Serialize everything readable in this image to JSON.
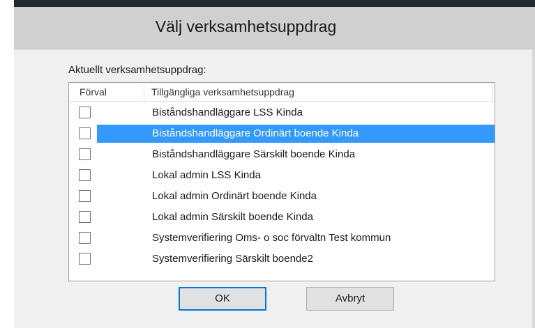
{
  "dialog": {
    "title": "Välj verksamhetsuppdrag",
    "group_label": "Aktuellt verksamhetsuppdrag:"
  },
  "list": {
    "columns": [
      "Förval",
      "Tillgängliga verksamhetsuppdrag"
    ],
    "rows": [
      {
        "label": "Biståndshandläggare LSS Kinda",
        "checked": false,
        "selected": false
      },
      {
        "label": "Biståndshandläggare Ordinärt boende Kinda",
        "checked": false,
        "selected": true
      },
      {
        "label": "Biståndshandläggare Särskilt boende Kinda",
        "checked": false,
        "selected": false
      },
      {
        "label": "Lokal admin LSS Kinda",
        "checked": false,
        "selected": false
      },
      {
        "label": "Lokal admin Ordinärt boende Kinda",
        "checked": false,
        "selected": false
      },
      {
        "label": "Lokal admin Särskilt boende Kinda",
        "checked": false,
        "selected": false
      },
      {
        "label": "Systemverifiering Oms- o soc förvaltn Test kommun",
        "checked": false,
        "selected": false
      },
      {
        "label": "Systemverifiering Särskilt boende2",
        "checked": false,
        "selected": false
      }
    ]
  },
  "buttons": {
    "ok_label": "OK",
    "cancel_label": "Avbryt"
  },
  "colors": {
    "selection": "#3399ff",
    "titlebar": "#d0d0d0",
    "dialog_bg": "#f0f0f0"
  }
}
